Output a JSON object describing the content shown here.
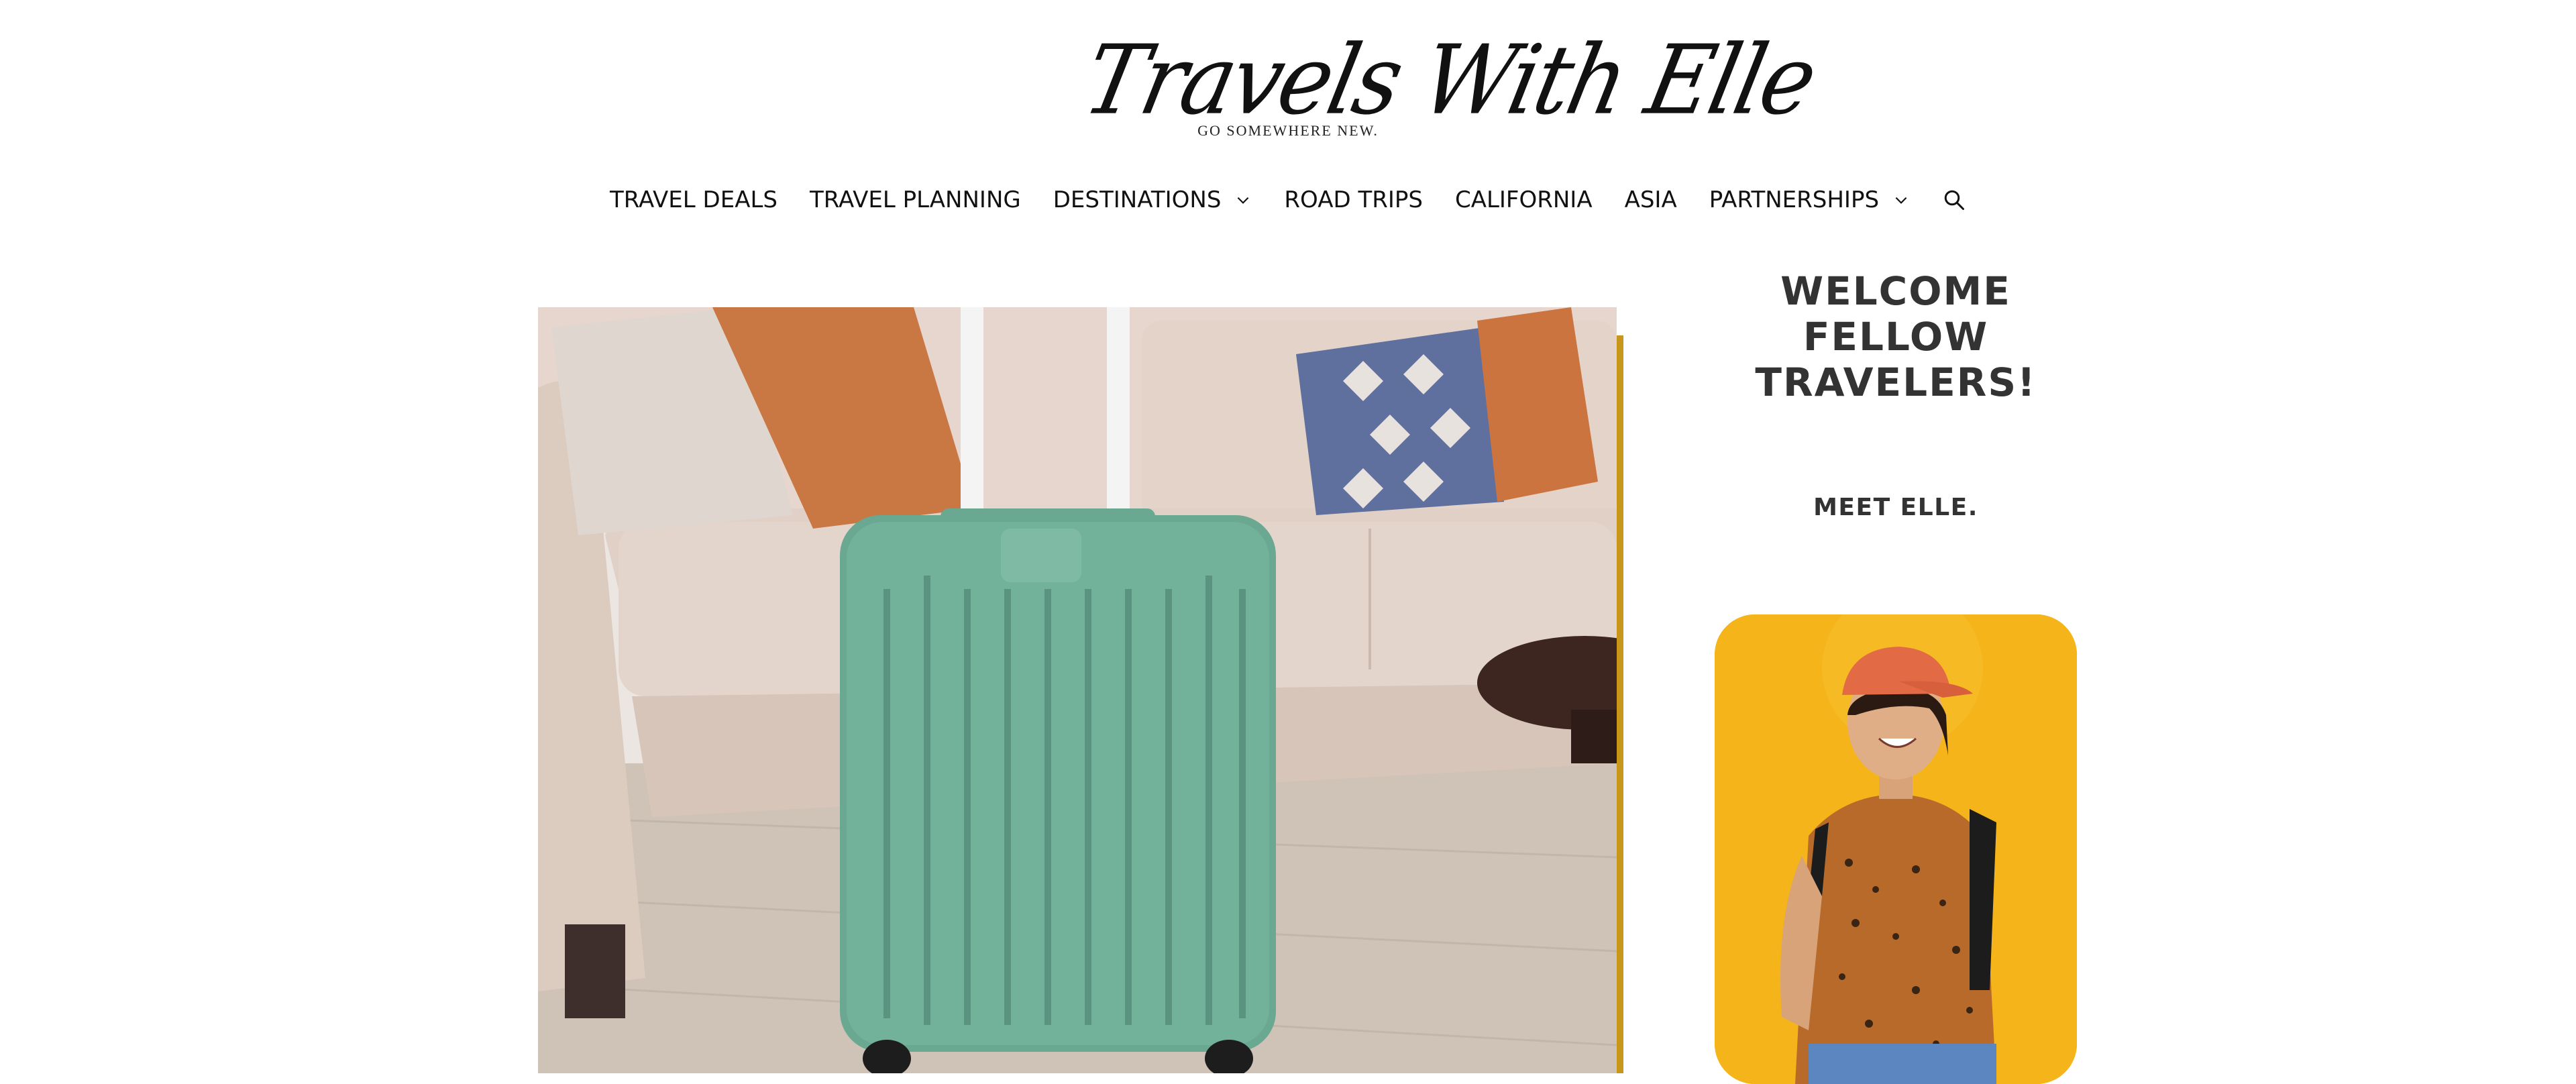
{
  "brand": {
    "logo_text": "Travels With Elle",
    "tagline": "GO SOMEWHERE NEW."
  },
  "nav": {
    "items": [
      {
        "label": "TRAVEL DEALS",
        "has_dropdown": false
      },
      {
        "label": "TRAVEL PLANNING",
        "has_dropdown": false
      },
      {
        "label": "DESTINATIONS",
        "has_dropdown": true
      },
      {
        "label": "ROAD TRIPS",
        "has_dropdown": false
      },
      {
        "label": "CALIFORNIA",
        "has_dropdown": false
      },
      {
        "label": "ASIA",
        "has_dropdown": false
      },
      {
        "label": "PARTNERSHIPS",
        "has_dropdown": true
      }
    ],
    "search_icon": "search-icon"
  },
  "feature": {
    "accent_color": "#c8961a",
    "suitcase_color": "#6aa891"
  },
  "sidebar": {
    "welcome_heading": "WELCOME FELLOW TRAVELERS!",
    "meet_heading": "MEET ELLE.",
    "avatar_bg_color": "#f3b41c"
  }
}
